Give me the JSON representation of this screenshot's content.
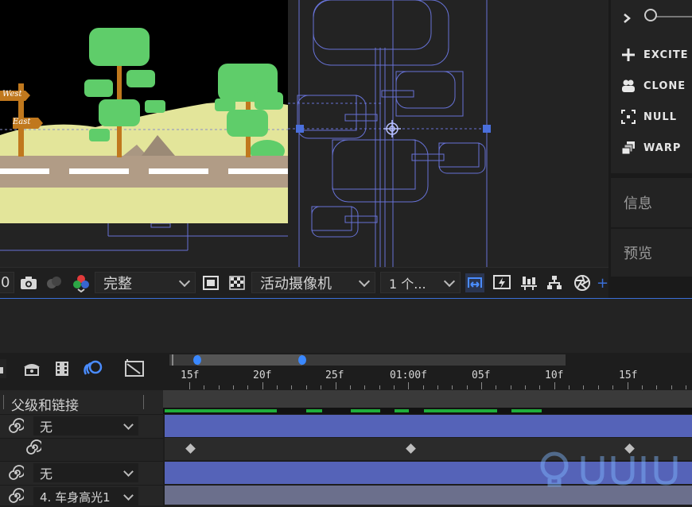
{
  "scene": {
    "sign_west": "West",
    "sign_east": "East"
  },
  "tools": {
    "excite": "EXCITE",
    "clone": "CLONE",
    "null": "NULL",
    "warp": "WARP"
  },
  "panels": {
    "info": "信息",
    "preview": "预览"
  },
  "viewer_toolbar": {
    "zoom_value": "0",
    "resolution": "完整",
    "camera": "活动摄像机",
    "views": "1 个..."
  },
  "timeline": {
    "ruler_labels": [
      "15f",
      "20f",
      "25f",
      "01:00f",
      "05f",
      "10f",
      "15f"
    ],
    "column_header": "父级和链接",
    "layers": [
      {
        "parent": "无"
      },
      {
        "parent": ""
      },
      {
        "parent": "无"
      },
      {
        "parent": "4. 车身高光1"
      }
    ]
  },
  "colors": {
    "accent": "#3a6fd8",
    "track_blue": "#5563b8",
    "work_area_green": "#1fae3b",
    "sky": "#000000",
    "grass": "#e3e59a",
    "road": "#b19c86",
    "tree": "#5fcd6a",
    "trunk": "#c0781d"
  }
}
